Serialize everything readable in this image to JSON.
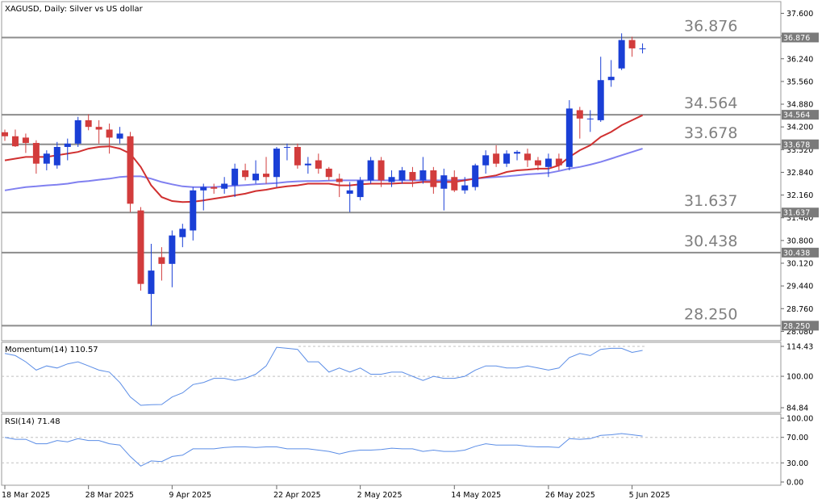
{
  "title": "XAGUSD, Daily:  Silver vs US dollar",
  "x_labels": [
    "18 Mar 2025",
    "28 Mar 2025",
    "9 Apr 2025",
    "22 Apr 2025",
    "2 May 2025",
    "14 May 2025",
    "26 May 2025",
    "5 Jun 2025"
  ],
  "price_ticks": [
    "37.600",
    "36.920",
    "36.240",
    "35.560",
    "34.880",
    "34.200",
    "33.520",
    "32.840",
    "32.160",
    "31.480",
    "30.800",
    "30.120",
    "29.440",
    "28.760",
    "28.080"
  ],
  "levels": [
    {
      "value": 36.876,
      "label": "36.876",
      "tag": "36.876"
    },
    {
      "value": 34.564,
      "label": "34.564",
      "tag": "34.564"
    },
    {
      "value": 33.678,
      "label": "33.678",
      "tag": "33.678"
    },
    {
      "value": 31.637,
      "label": "31.637",
      "tag": "31.637"
    },
    {
      "value": 30.438,
      "label": "30.438",
      "tag": "30.438"
    },
    {
      "value": 28.25,
      "label": "28.250",
      "tag": "28.250"
    }
  ],
  "momentum": {
    "label": "Momentum(14) 110.57",
    "ticks": [
      "114.43",
      "100.00",
      "84.84"
    ]
  },
  "rsi": {
    "label": "RSI(14) 71.48",
    "ticks": [
      "100.00",
      "70.00",
      "30.00",
      "0.00"
    ]
  },
  "colors": {
    "bull": "#1a3fd6",
    "bear": "#d23c3c",
    "ma_fast": "#d03030",
    "ma_slow": "#8080f0",
    "indicator": "#5b8de6",
    "level": "#8c8c8c"
  },
  "chart_data": {
    "type": "candlestick",
    "x_tick_labels": [
      "18 Mar 2025",
      "28 Mar 2025",
      "9 Apr 2025",
      "22 Apr 2025",
      "2 May 2025",
      "14 May 2025",
      "26 May 2025",
      "5 Jun 2025"
    ],
    "ohlc": [
      [
        34.04,
        34.12,
        33.78,
        33.92
      ],
      [
        33.92,
        34.12,
        33.6,
        33.62
      ],
      [
        33.88,
        34.0,
        33.42,
        33.72
      ],
      [
        33.72,
        33.8,
        32.8,
        33.1
      ],
      [
        33.1,
        33.5,
        32.9,
        33.4
      ],
      [
        33.05,
        33.75,
        32.95,
        33.6
      ],
      [
        33.6,
        33.85,
        33.2,
        33.7
      ],
      [
        33.7,
        34.5,
        33.6,
        34.4
      ],
      [
        34.4,
        34.58,
        34.1,
        34.2
      ],
      [
        34.2,
        34.4,
        33.7,
        34.12
      ],
      [
        34.12,
        34.3,
        33.4,
        33.88
      ],
      [
        33.85,
        34.2,
        33.7,
        34.0
      ],
      [
        33.92,
        34.05,
        31.65,
        31.9
      ],
      [
        31.7,
        31.8,
        29.3,
        29.5
      ],
      [
        29.2,
        30.7,
        28.25,
        29.9
      ],
      [
        30.3,
        30.6,
        29.6,
        30.1
      ],
      [
        30.1,
        31.1,
        29.4,
        30.95
      ],
      [
        30.9,
        31.3,
        30.6,
        31.15
      ],
      [
        31.1,
        32.4,
        30.8,
        32.3
      ],
      [
        32.3,
        32.5,
        31.7,
        32.4
      ],
      [
        32.4,
        32.5,
        32.2,
        32.35
      ],
      [
        32.35,
        32.7,
        32.2,
        32.5
      ],
      [
        32.45,
        33.1,
        32.1,
        32.95
      ],
      [
        32.9,
        33.1,
        32.6,
        32.7
      ],
      [
        32.6,
        33.2,
        32.5,
        32.8
      ],
      [
        32.8,
        33.3,
        32.5,
        32.7
      ],
      [
        32.7,
        33.6,
        32.4,
        33.55
      ],
      [
        33.6,
        33.7,
        33.2,
        33.6
      ],
      [
        33.6,
        33.7,
        32.95,
        33.05
      ],
      [
        33.05,
        33.3,
        32.8,
        33.1
      ],
      [
        33.2,
        33.4,
        32.8,
        32.95
      ],
      [
        32.95,
        33.0,
        32.6,
        32.7
      ],
      [
        32.65,
        32.8,
        32.1,
        32.55
      ],
      [
        32.2,
        32.55,
        31.65,
        32.3
      ],
      [
        32.1,
        32.7,
        32.0,
        32.6
      ],
      [
        32.6,
        33.3,
        32.5,
        33.2
      ],
      [
        33.2,
        33.3,
        32.4,
        32.6
      ],
      [
        32.55,
        32.9,
        32.4,
        32.7
      ],
      [
        32.6,
        33.0,
        32.5,
        32.9
      ],
      [
        32.85,
        33.0,
        32.4,
        32.6
      ],
      [
        32.6,
        33.3,
        32.5,
        32.9
      ],
      [
        32.9,
        33.0,
        32.2,
        32.4
      ],
      [
        32.35,
        32.95,
        31.7,
        32.75
      ],
      [
        32.7,
        32.9,
        32.25,
        32.3
      ],
      [
        32.3,
        32.7,
        32.2,
        32.45
      ],
      [
        32.4,
        33.1,
        32.3,
        33.05
      ],
      [
        33.05,
        33.5,
        32.8,
        33.35
      ],
      [
        33.4,
        33.65,
        33.0,
        33.1
      ],
      [
        33.1,
        33.5,
        33.0,
        33.4
      ],
      [
        33.4,
        33.5,
        33.2,
        33.45
      ],
      [
        33.4,
        33.55,
        33.0,
        33.2
      ],
      [
        33.2,
        33.3,
        32.9,
        33.05
      ],
      [
        33.0,
        33.4,
        32.7,
        33.25
      ],
      [
        33.25,
        33.4,
        32.9,
        33.05
      ],
      [
        33.0,
        35.0,
        32.9,
        34.75
      ],
      [
        34.7,
        34.8,
        33.85,
        34.45
      ],
      [
        34.45,
        34.7,
        34.05,
        34.45
      ],
      [
        34.4,
        36.3,
        34.35,
        35.6
      ],
      [
        35.6,
        36.2,
        35.4,
        35.7
      ],
      [
        35.95,
        37.0,
        35.9,
        36.8
      ],
      [
        36.8,
        36.9,
        36.3,
        36.55
      ],
      [
        36.55,
        36.7,
        36.4,
        36.55
      ]
    ],
    "ma_fast": [
      33.2,
      33.25,
      33.3,
      33.3,
      33.3,
      33.35,
      33.4,
      33.45,
      33.55,
      33.6,
      33.62,
      33.55,
      33.4,
      33.0,
      32.45,
      32.1,
      31.98,
      31.95,
      31.96,
      32.0,
      32.05,
      32.1,
      32.15,
      32.2,
      32.28,
      32.32,
      32.38,
      32.42,
      32.45,
      32.5,
      32.5,
      32.5,
      32.45,
      32.45,
      32.48,
      32.5,
      32.5,
      32.5,
      32.52,
      32.52,
      32.55,
      32.55,
      32.55,
      32.55,
      32.6,
      32.65,
      32.7,
      32.75,
      32.85,
      32.9,
      32.92,
      32.95,
      32.95,
      33.05,
      33.3,
      33.5,
      33.65,
      33.9,
      34.05,
      34.25,
      34.4,
      34.55
    ],
    "ma_slow": [
      32.3,
      32.35,
      32.4,
      32.42,
      32.45,
      32.47,
      32.5,
      32.55,
      32.58,
      32.62,
      32.65,
      32.7,
      32.72,
      32.72,
      32.65,
      32.55,
      32.48,
      32.42,
      32.4,
      32.4,
      32.4,
      32.42,
      32.44,
      32.46,
      32.48,
      32.5,
      32.52,
      32.55,
      32.57,
      32.58,
      32.58,
      32.59,
      32.6,
      32.6,
      32.6,
      32.6,
      32.6,
      32.6,
      32.6,
      32.6,
      32.6,
      32.6,
      32.6,
      32.6,
      32.62,
      32.65,
      32.68,
      32.7,
      32.72,
      32.75,
      32.78,
      32.8,
      32.82,
      32.88,
      32.95,
      33.0,
      33.07,
      33.15,
      33.25,
      33.35,
      33.45,
      33.55
    ],
    "momentum_values": [
      111,
      110,
      107,
      103,
      105,
      104,
      106,
      107,
      105,
      103,
      102,
      97,
      90,
      86,
      86.3,
      86.4,
      90,
      92,
      96,
      97,
      99,
      99,
      98,
      99,
      101,
      105,
      114,
      113.5,
      113,
      107,
      107,
      102,
      104,
      102,
      104,
      101,
      101,
      102,
      102,
      100,
      98,
      100,
      99,
      99,
      100,
      103,
      105,
      105,
      104,
      104,
      105,
      104,
      103,
      104,
      109,
      111,
      110,
      113,
      113.5,
      113.5,
      111.5,
      112.5
    ],
    "momentum_ylim": [
      84.84,
      114.43
    ],
    "rsi_values": [
      70,
      67,
      67,
      60,
      60,
      65,
      63,
      68,
      65,
      65,
      60,
      58,
      40,
      25,
      33,
      32,
      40,
      42,
      52,
      52,
      52,
      54,
      55,
      55,
      54,
      55,
      55,
      52,
      52,
      52,
      50,
      48,
      44,
      48,
      50,
      50,
      51,
      53,
      52,
      52,
      48,
      50,
      48,
      48,
      50,
      56,
      60,
      58,
      58,
      58,
      56,
      55,
      55,
      54,
      68,
      67,
      68,
      73,
      74,
      76,
      74,
      72
    ],
    "rsi_ylim": [
      0,
      100
    ],
    "price_ylim": [
      27.8,
      37.95
    ]
  }
}
